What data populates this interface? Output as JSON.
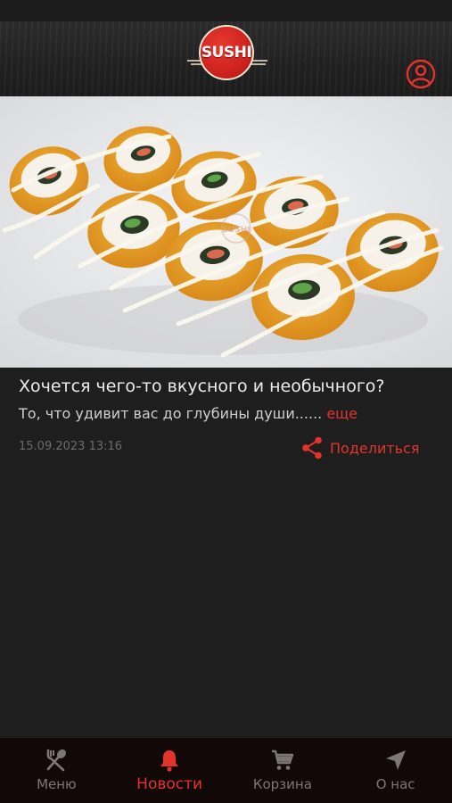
{
  "header": {
    "logo_text": "SUSHI"
  },
  "news": {
    "title": "Хочется чего-то вкусного и необычного?",
    "description": "То, что удивит вас до глубины души......",
    "more": "еще",
    "date": "15.09.2023 13:16",
    "share_label": "Поделиться"
  },
  "tabs": [
    {
      "label": "Меню",
      "icon": "fork-spoon-icon",
      "active": false
    },
    {
      "label": "Новости",
      "icon": "bell-icon",
      "active": true
    },
    {
      "label": "Корзина",
      "icon": "cart-icon",
      "active": false
    },
    {
      "label": "О нас",
      "icon": "location-arrow-icon",
      "active": false
    }
  ],
  "colors": {
    "accent": "#e4332b",
    "background": "#1e1e1f",
    "tabbar": "#120808",
    "inactive": "#7d7676"
  }
}
